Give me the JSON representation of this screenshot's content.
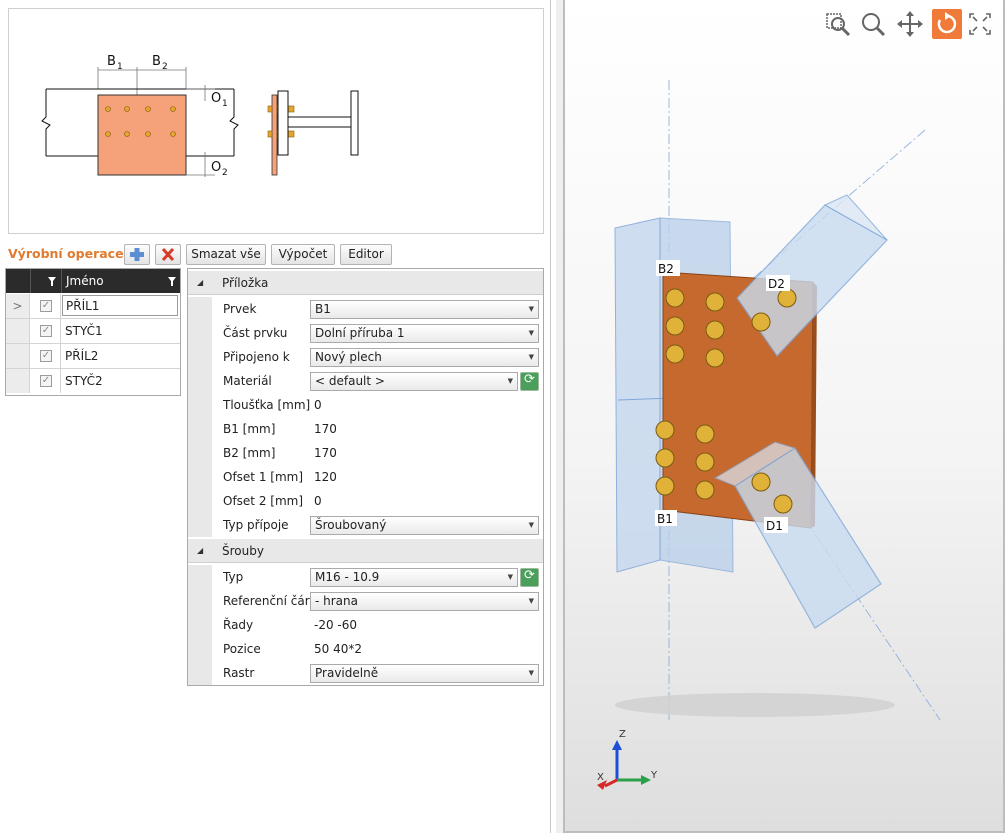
{
  "preview": {
    "labels": {
      "b1": "B",
      "b1_sub": "1",
      "b2": "B",
      "b2_sub": "2",
      "o1": "O",
      "o1_sub": "1",
      "o2": "O",
      "o2_sub": "2"
    }
  },
  "toolbar": {
    "title": "Výrobní operace",
    "add_icon": "add-icon",
    "delete_icon": "delete-icon",
    "clear_all": "Smazat vše",
    "calculate": "Výpočet",
    "editor": "Editor"
  },
  "operations": {
    "header_name": "Jméno",
    "rows": [
      {
        "name": "PŘÍL1",
        "checked": true,
        "selected": true
      },
      {
        "name": "STYČ1",
        "checked": true,
        "selected": false
      },
      {
        "name": "PŘÍL2",
        "checked": true,
        "selected": false
      },
      {
        "name": "STYČ2",
        "checked": true,
        "selected": false
      }
    ]
  },
  "properties": {
    "plate": {
      "header": "Příložka",
      "rows": [
        {
          "label": "Prvek",
          "value": "B1",
          "type": "select"
        },
        {
          "label": "Část prvku",
          "value": "Dolní příruba 1",
          "type": "select"
        },
        {
          "label": "Připojeno k",
          "value": "Nový plech",
          "type": "select"
        },
        {
          "label": "Materiál",
          "value": "< default >",
          "type": "select-refresh"
        },
        {
          "label": "Tloušťka [mm]",
          "value": "0",
          "type": "text"
        },
        {
          "label": "B1 [mm]",
          "value": "170",
          "type": "text"
        },
        {
          "label": "B2 [mm]",
          "value": "170",
          "type": "text"
        },
        {
          "label": "Ofset 1 [mm]",
          "value": "120",
          "type": "text"
        },
        {
          "label": "Ofset 2 [mm]",
          "value": "0",
          "type": "text"
        },
        {
          "label": "Typ přípoje",
          "value": "Šroubovaný",
          "type": "select"
        }
      ]
    },
    "bolts": {
      "header": "Šrouby",
      "rows": [
        {
          "label": "Typ",
          "value": "M16 - 10.9",
          "type": "select-refresh"
        },
        {
          "label": "Referenční čára",
          "value": "- hrana",
          "type": "select"
        },
        {
          "label": "Řady",
          "value": "-20 -60",
          "type": "text"
        },
        {
          "label": "Pozice",
          "value": "50 40*2",
          "type": "text"
        },
        {
          "label": "Rastr",
          "value": "Pravidelně",
          "type": "select"
        }
      ]
    }
  },
  "viewport": {
    "tools": [
      "zoom-window-icon",
      "zoom-icon",
      "pan-icon",
      "rotate-icon",
      "fit-all-icon"
    ],
    "active_tool": "rotate-icon",
    "member_labels": {
      "b2": "B2",
      "d2": "D2",
      "b1": "B1",
      "d1": "D1"
    },
    "axes": {
      "z": "Z",
      "y": "Y",
      "x": "X"
    },
    "colors": {
      "plate": "#c6692e",
      "bolt": "#e0b23a",
      "member": "#a9c8e8"
    }
  }
}
